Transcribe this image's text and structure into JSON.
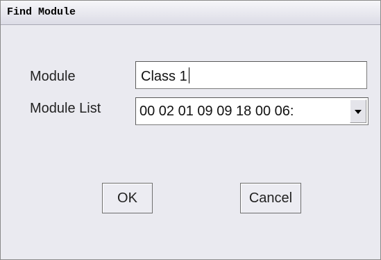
{
  "window": {
    "title": "Find Module"
  },
  "form": {
    "module_label": "Module",
    "module_value": "Class 1",
    "module_list_label": "Module List",
    "module_list_selected": "00 02 01 09 09 18 00 06:"
  },
  "buttons": {
    "ok_label": "OK",
    "cancel_label": "Cancel"
  },
  "icons": {
    "dropdown": "chevron-down-icon"
  }
}
